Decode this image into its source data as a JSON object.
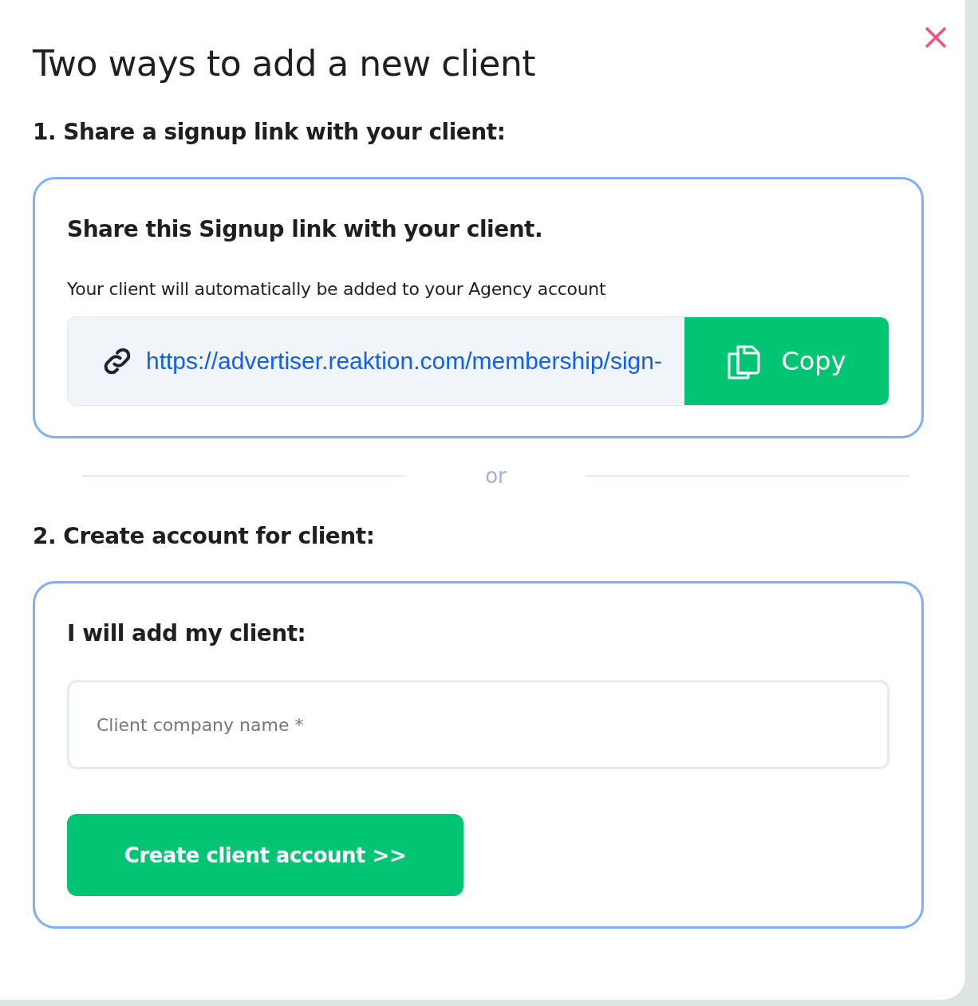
{
  "dialog": {
    "title": "Two ways to add a new client"
  },
  "sections": [
    {
      "kind": "link",
      "heading": "1. Share a signup link with your client:",
      "card_title": "Share this Signup link with your client.",
      "description": "Your client will automatically be added to your Agency account",
      "link": "https://advertiser.reaktion.com/membership/sign-",
      "button": "Copy"
    },
    {
      "kind": "form",
      "heading": "2. Create account for client:",
      "card_title": "I will add my client:",
      "placeholder": "Client company name *",
      "button": "Create client account >>"
    }
  ],
  "divider": "or"
}
